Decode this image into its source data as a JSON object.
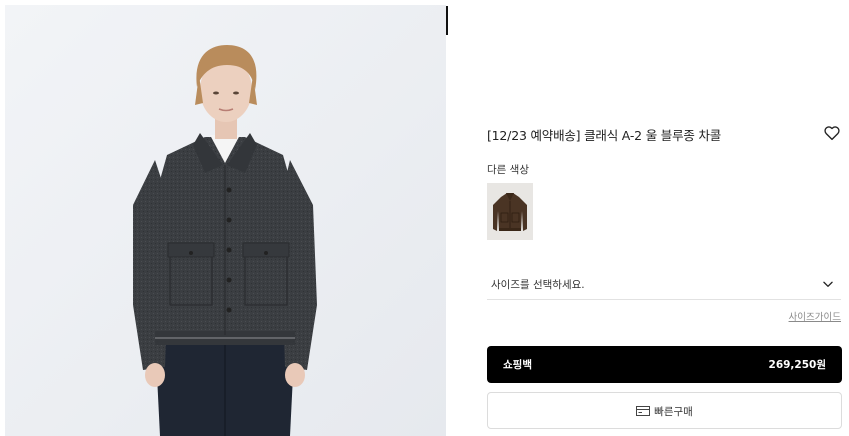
{
  "product": {
    "title": "[12/23 예약배송] 클래식 A-2 울 블루종 차콜",
    "image": "model-wearing-charcoal-wool-jacket",
    "wishlist_icon": "heart-outline-icon"
  },
  "colors": {
    "label": "다른 색상",
    "swatches": [
      {
        "name": "brown-jacket-thumbnail",
        "color": "#4a3424"
      }
    ]
  },
  "size": {
    "placeholder": "사이즈를 선택하세요.",
    "icon": "chevron-down-icon",
    "guide_label": "사이즈가이드"
  },
  "actions": {
    "cart_label": "쇼핑백",
    "price": "269,250원",
    "quick_buy_label": "빠른구매",
    "quick_buy_icon": "card-icon"
  },
  "colors_theme": {
    "primary_button": "#000000",
    "background": "#ffffff",
    "jacket": "#3a3d40",
    "image_bg": "#eef0f3"
  }
}
